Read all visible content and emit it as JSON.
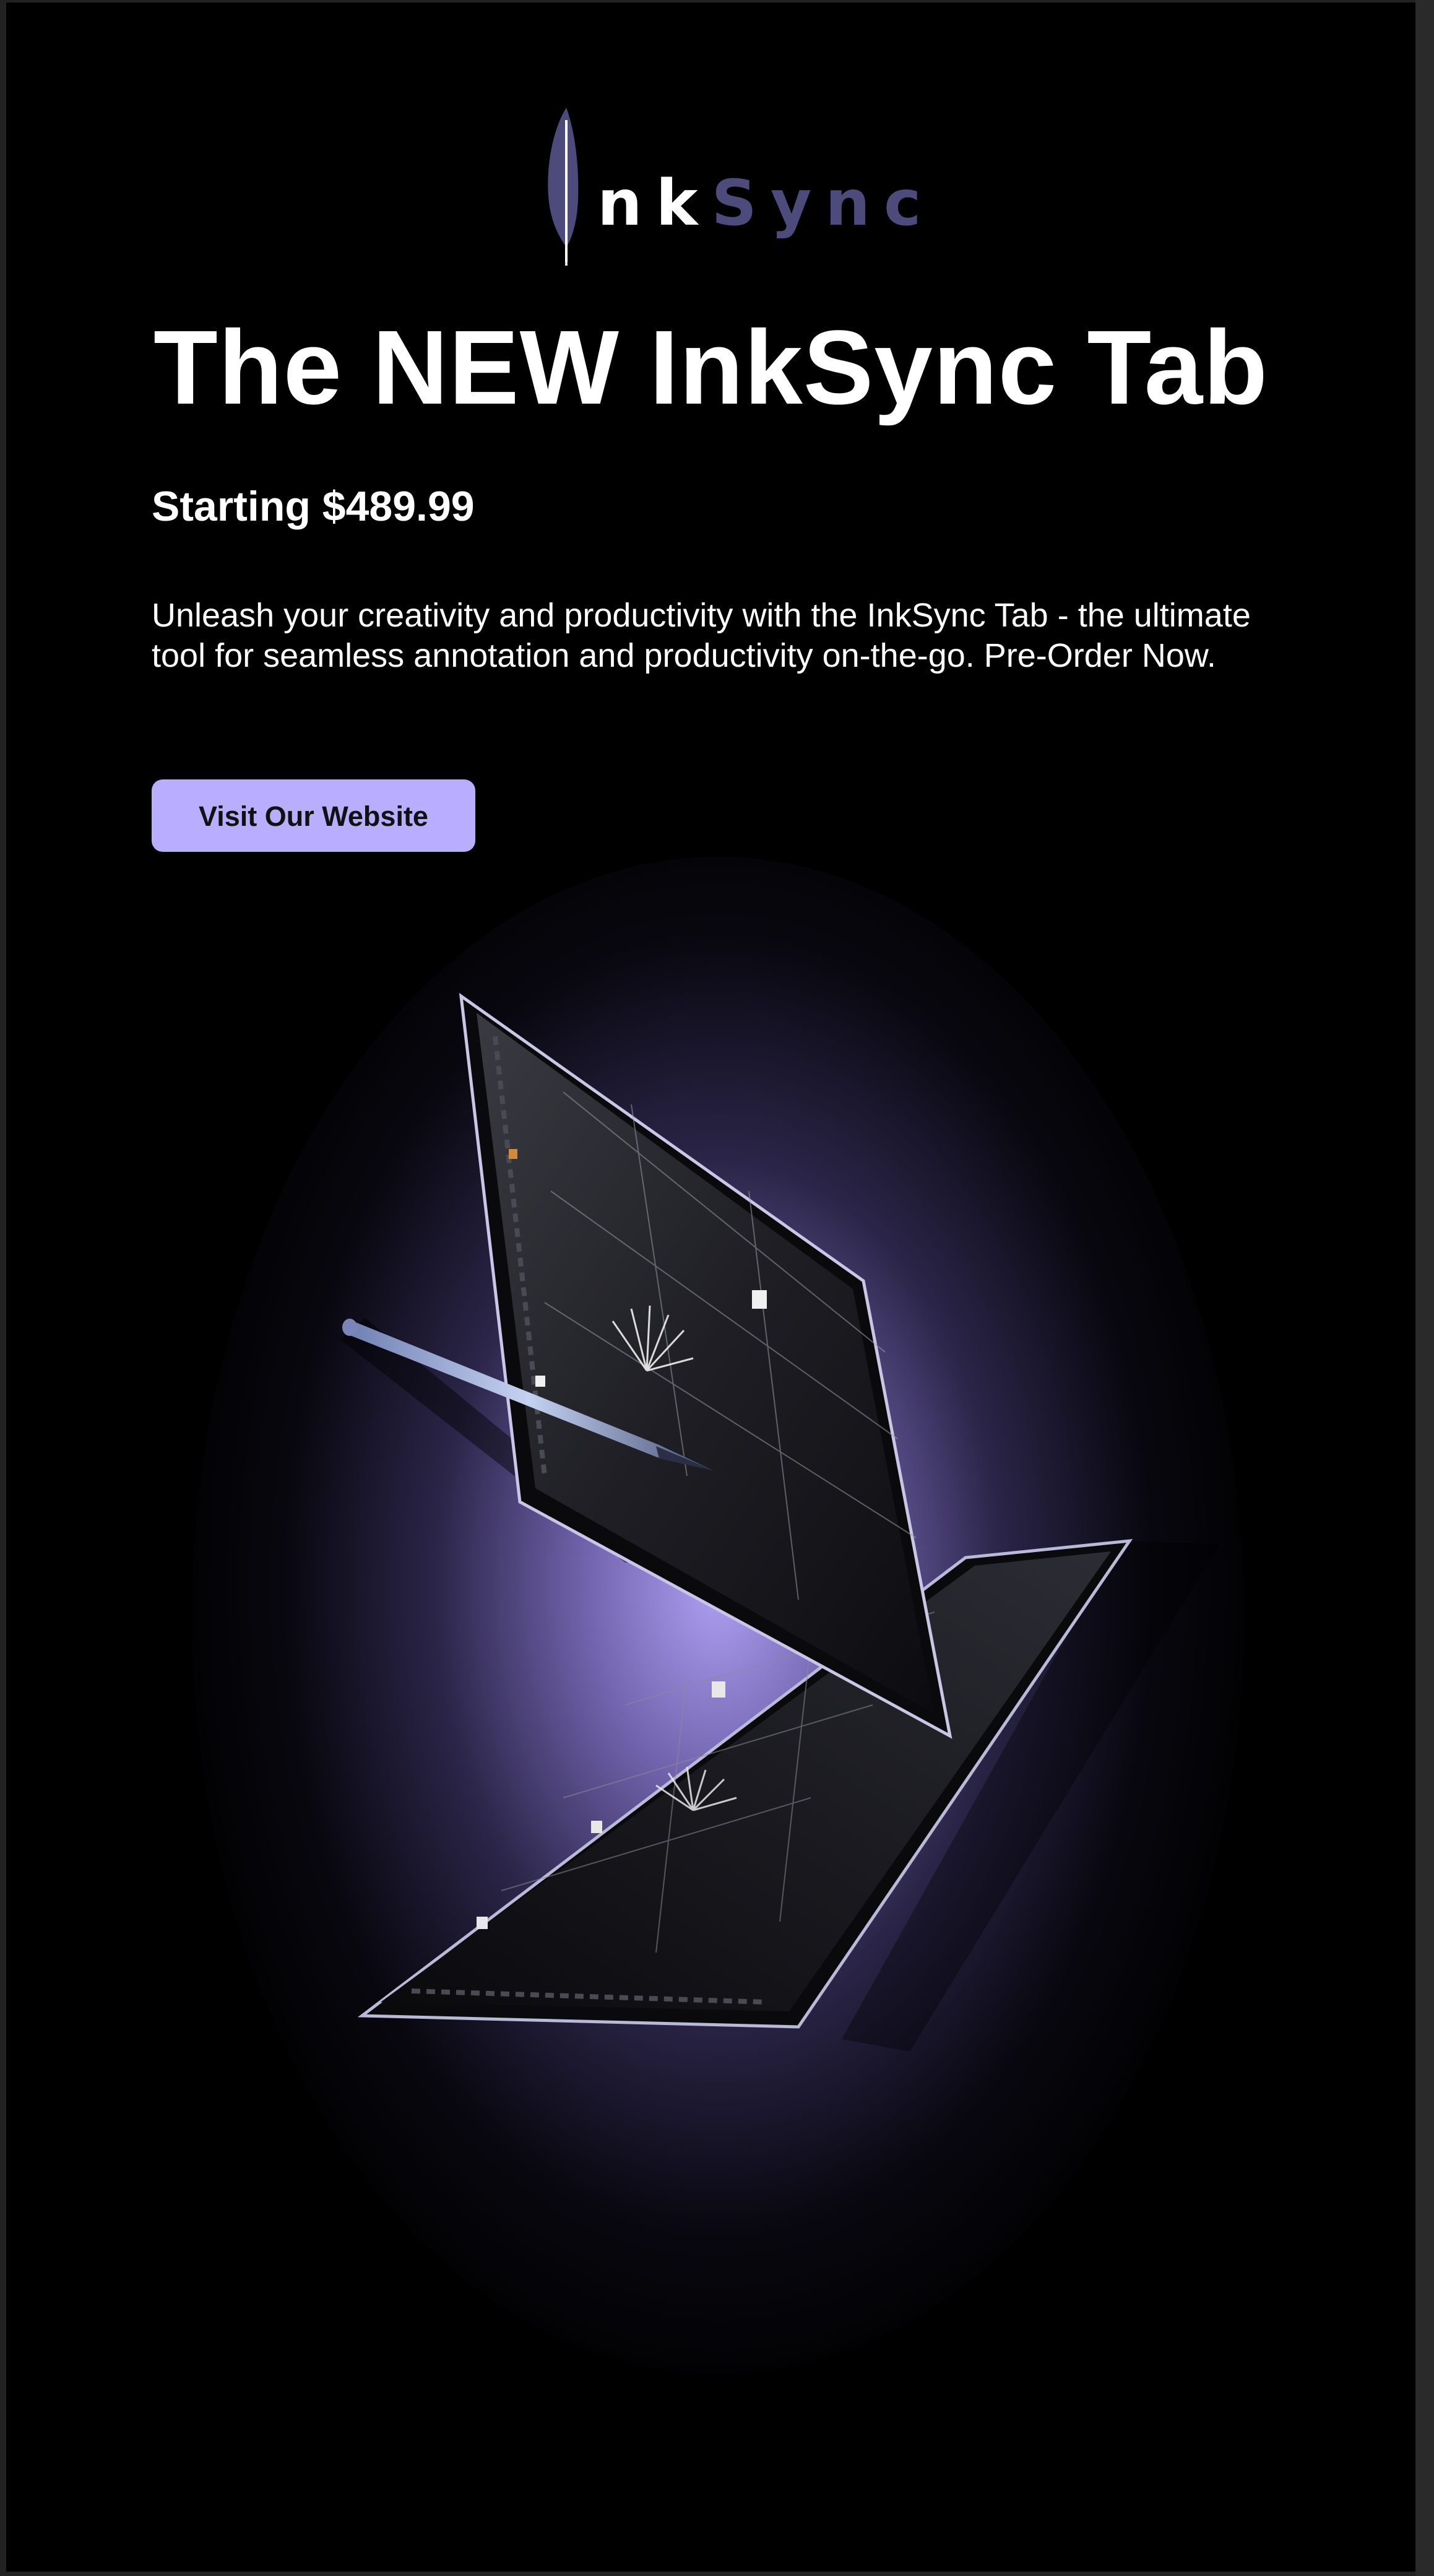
{
  "brand": {
    "logo_text_white": "nk",
    "logo_text_purple": "Sync",
    "logo_color": "#4d4a7c",
    "accent_color": "#b8adff",
    "background_color": "#000000"
  },
  "hero": {
    "title": "The NEW InkSync Tab",
    "price": "Starting $489.99",
    "description": "Unleash your creativity and productivity with the InkSync Tab - the ultimate tool for seamless annotation and productivity on-the-go. Pre-Order Now.",
    "cta_label": "Visit Our Website"
  },
  "illustration": {
    "subject": "two tablets with stylus",
    "glow_color": "#b8a8ff"
  }
}
